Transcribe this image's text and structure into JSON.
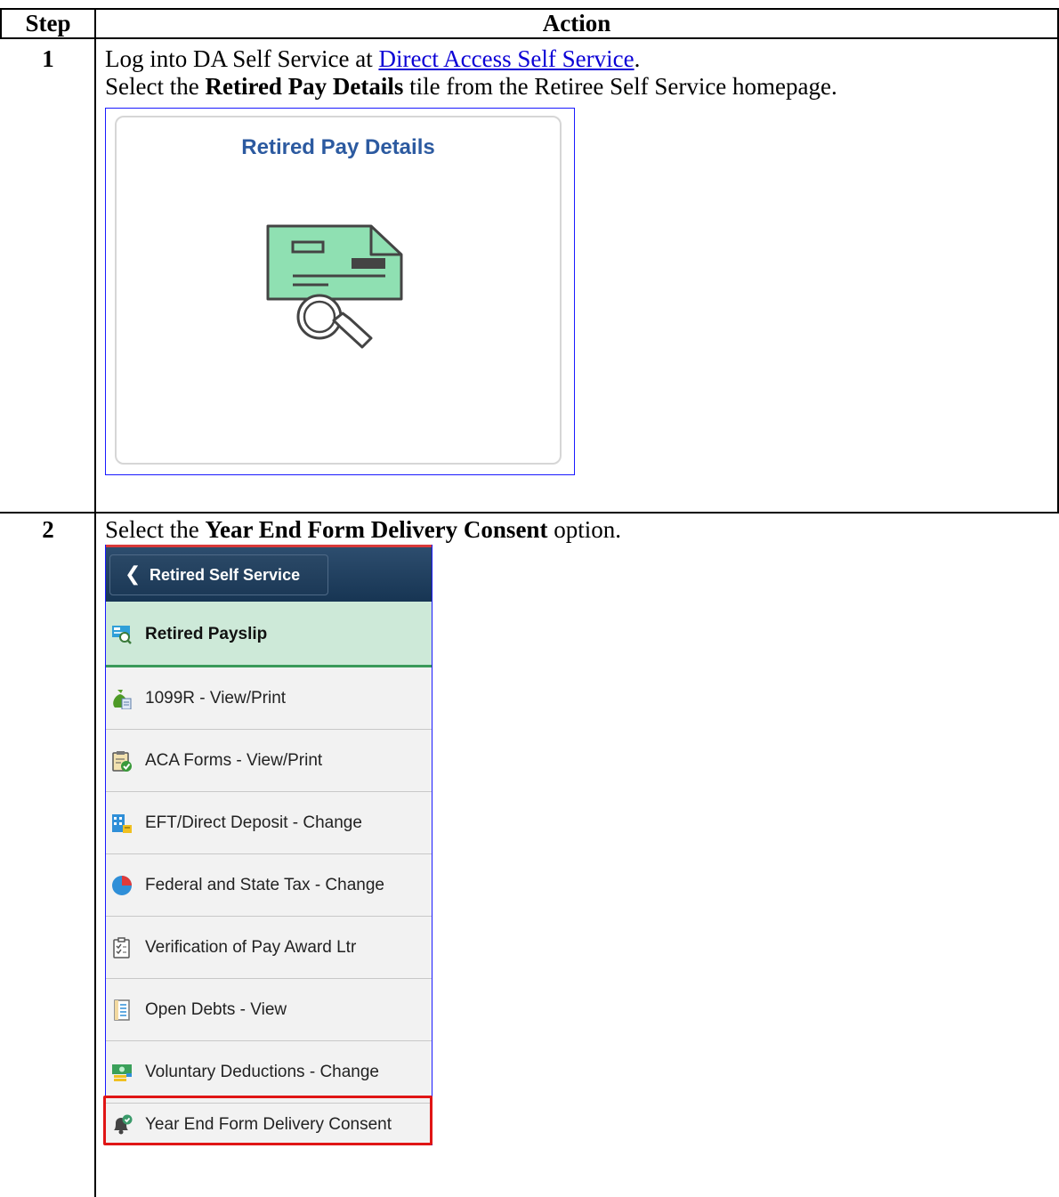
{
  "table": {
    "header_step": "Step",
    "header_action": "Action"
  },
  "rows": [
    {
      "step": "1",
      "line1_pre": "Log into DA Self Service at ",
      "line1_link": "Direct Access Self Service",
      "line1_post": ".",
      "line2_pre": "Select the ",
      "line2_bold": "Retired Pay Details",
      "line2_post": " tile from the Retiree Self Service homepage."
    },
    {
      "step": "2",
      "line1_pre": "Select the ",
      "line1_bold": "Year End Form Delivery Consent",
      "line1_post": " option."
    }
  ],
  "tile": {
    "title": "Retired Pay Details",
    "icon": "check-magnifier-icon",
    "colors": {
      "title": "#2c5aa0",
      "check_fill": "#8fe0b2"
    }
  },
  "menu": {
    "back_label": "Retired Self Service",
    "items": [
      {
        "label": "Retired Payslip",
        "icon": "payslip-icon",
        "active": true
      },
      {
        "label": "1099R - View/Print",
        "icon": "money-bag-icon"
      },
      {
        "label": "ACA Forms - View/Print",
        "icon": "clipboard-check-icon"
      },
      {
        "label": "EFT/Direct Deposit - Change",
        "icon": "bank-icon"
      },
      {
        "label": "Federal and State Tax - Change",
        "icon": "pie-chart-icon"
      },
      {
        "label": "Verification of Pay Award Ltr",
        "icon": "checklist-icon"
      },
      {
        "label": "Open Debts - View",
        "icon": "document-list-icon"
      },
      {
        "label": "Voluntary Deductions - Change",
        "icon": "cash-icon"
      },
      {
        "label": "Year End Form Delivery Consent",
        "icon": "bell-check-icon",
        "highlighted": true
      }
    ],
    "colors": {
      "header": "#1f3d5c",
      "active_bg": "#cde9d8",
      "highlight": "#e01515"
    }
  }
}
